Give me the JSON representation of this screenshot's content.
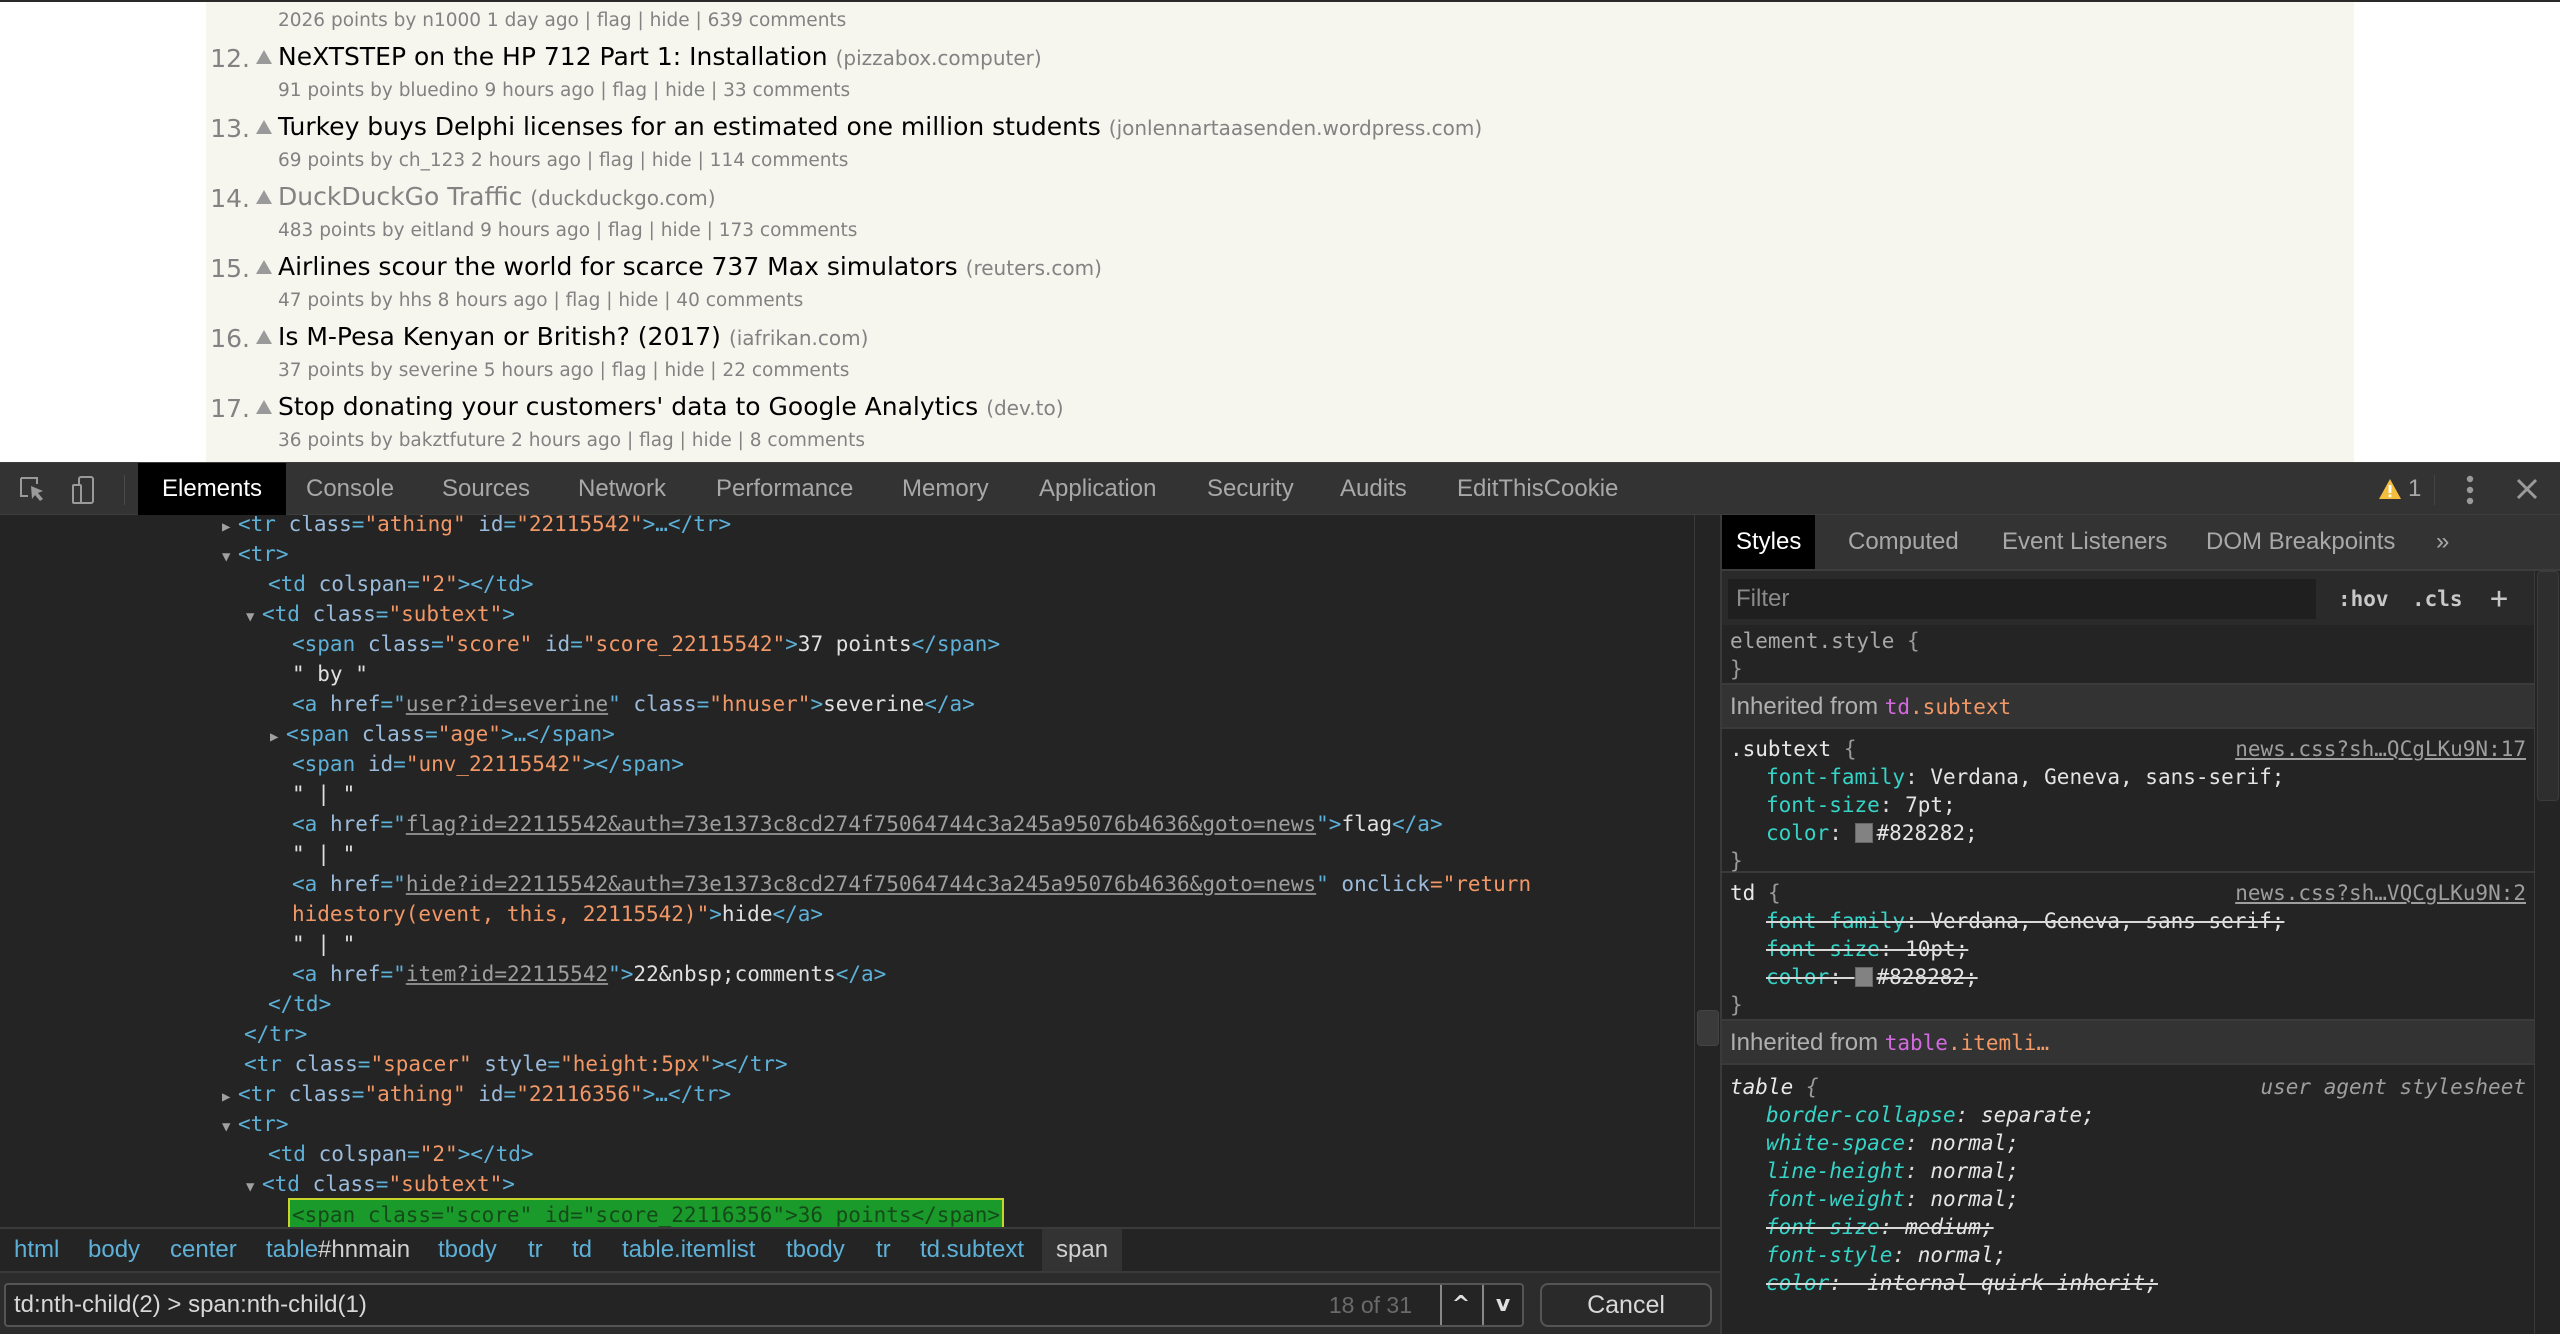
{
  "hn": {
    "partial_item": {
      "subtext": "2026 points by n1000 1 day ago | flag | hide | 639 comments"
    },
    "items": [
      {
        "rank": "12.",
        "title": "NeXTSTEP on the HP 712 Part 1: Installation",
        "site": "(pizzabox.computer)",
        "subtext": "91 points by bluedino 9 hours ago | flag | hide | 33 comments",
        "visited": false
      },
      {
        "rank": "13.",
        "title": "Turkey buys Delphi licenses for an estimated one million students",
        "site": "(jonlennartaasenden.wordpress.com)",
        "subtext": "69 points by ch_123 2 hours ago | flag | hide | 114 comments",
        "visited": false
      },
      {
        "rank": "14.",
        "title": "DuckDuckGo Traffic",
        "site": "(duckduckgo.com)",
        "subtext": "483 points by eitland 9 hours ago | flag | hide | 173 comments",
        "visited": true
      },
      {
        "rank": "15.",
        "title": "Airlines scour the world for scarce 737 Max simulators",
        "site": "(reuters.com)",
        "subtext": "47 points by hhs 8 hours ago | flag | hide | 40 comments",
        "visited": false
      },
      {
        "rank": "16.",
        "title": "Is M-Pesa Kenyan or British? (2017)",
        "site": "(iafrikan.com)",
        "subtext": "37 points by severine 5 hours ago | flag | hide | 22 comments",
        "visited": false
      },
      {
        "rank": "17.",
        "title": "Stop donating your customers' data to Google Analytics",
        "site": "(dev.to)",
        "subtext": "36 points by bakztfuture 2 hours ago | flag | hide | 8 comments",
        "visited": false
      }
    ]
  },
  "devtools": {
    "tabs": [
      "Elements",
      "Console",
      "Sources",
      "Network",
      "Performance",
      "Memory",
      "Application",
      "Security",
      "Audits",
      "EditThisCookie"
    ],
    "active_tab": "Elements",
    "warning_count": "1",
    "icons": {
      "inspect": "inspect-element-icon",
      "device": "device-toolbar-icon",
      "warning": "warning-icon",
      "menu": "kebab-menu-icon",
      "close": "close-icon"
    },
    "dom": {
      "l1": {
        "a_tag": "<tr ",
        "a_attr1": "class",
        "a_val1": "\"athing\"",
        "a_attr2": " id",
        "a_val2": "\"22115542\"",
        "a_close": ">…</tr>"
      },
      "l2": "<tr>",
      "l3": {
        "open": "<td ",
        "attr": "colspan",
        "val": "\"2\"",
        "close": "></td>"
      },
      "l4": {
        "open": "<td ",
        "attr": "class",
        "val": "\"subtext\"",
        "close": ">"
      },
      "l5": {
        "open": "<span ",
        "attr1": "class",
        "val1": "\"score\"",
        "attr2": " id",
        "val2": "\"score_22115542\"",
        "mid": ">",
        "text": "37 points",
        "close": "</span>"
      },
      "l6": "\" by \"",
      "l7": {
        "open": "<a ",
        "attr1": "href",
        "eq": "=\"",
        "link": "user?id=severine",
        "q": "\"",
        "attr2": " class",
        "val2": "\"hnuser\"",
        "mid": ">",
        "text": "severine",
        "close": "</a>"
      },
      "l8": {
        "open": "<span ",
        "attr": "class",
        "val": "\"age\"",
        "close": ">…</span>"
      },
      "l9": {
        "open": "<span ",
        "attr": "id",
        "val": "\"unv_22115542\"",
        "close": "></span>"
      },
      "l10": "\" | \"",
      "l11": {
        "open": "<a ",
        "attr": "href",
        "eq": "=\"",
        "link": "flag?id=22115542&auth=73e1373c8cd274f75064744c3a245a95076b4636&goto=news",
        "q": "\"",
        "mid": ">",
        "text": "flag",
        "close": "</a>"
      },
      "l12": "\" | \"",
      "l13": {
        "open": "<a ",
        "attr": "href",
        "eq": "=\"",
        "link": "hide?id=22115542&auth=73e1373c8cd274f75064744c3a245a95076b4636&goto=news",
        "q": "\"",
        "attr2": " onclick",
        "val2a": "=\"return"
      },
      "l14": {
        "val2b": "hidestory(event, this, 22115542)\"",
        "mid": ">",
        "text": "hide",
        "close": "</a>"
      },
      "l15": "\" | \"",
      "l16": {
        "open": "<a ",
        "attr": "href",
        "eq": "=\"",
        "link": "item?id=22115542",
        "q": "\"",
        "mid": ">",
        "text": "22&nbsp;comments",
        "close": "</a>"
      },
      "l17": "</td>",
      "l18": "</tr>",
      "l19": {
        "open": "<tr ",
        "attr1": "class",
        "val1": "\"spacer\"",
        "attr2": " style",
        "val2": "\"height:5px\"",
        "close": "></tr>"
      },
      "l20": {
        "open": "<tr ",
        "attr1": "class",
        "val1": "\"athing\"",
        "attr2": " id",
        "val2": "\"22116356\"",
        "close": ">…</tr>"
      },
      "l21": "<tr>",
      "l22": {
        "open": "<td ",
        "attr": "colspan",
        "val": "\"2\"",
        "close": "></td>"
      },
      "l23": {
        "open": "<td ",
        "attr": "class",
        "val": "\"subtext\"",
        "close": ">"
      },
      "l24": "<span class=\"score\" id=\"score_22116356\">36 points</span>"
    },
    "breadcrumbs": [
      {
        "tag": "html",
        "id": ""
      },
      {
        "tag": "body",
        "id": ""
      },
      {
        "tag": "center",
        "id": ""
      },
      {
        "tag": "table",
        "id": "#hnmain"
      },
      {
        "tag": "tbody",
        "id": ""
      },
      {
        "tag": "tr",
        "id": ""
      },
      {
        "tag": "td",
        "id": ""
      },
      {
        "tag": "table.itemlist",
        "id": ""
      },
      {
        "tag": "tbody",
        "id": ""
      },
      {
        "tag": "tr",
        "id": ""
      },
      {
        "tag": "td.subtext",
        "id": ""
      },
      {
        "tag": "span",
        "id": ""
      }
    ],
    "search": {
      "value": "td:nth-child(2) > span:nth-child(1)",
      "count": "18 of 31",
      "prev": "^",
      "next": "v",
      "cancel": "Cancel"
    },
    "styles": {
      "tabs": [
        "Styles",
        "Computed",
        "Event Listeners",
        "DOM Breakpoints",
        "»"
      ],
      "active_tab": "Styles",
      "filter_placeholder": "Filter",
      "hov": ":hov",
      "cls": ".cls",
      "add": "+",
      "element_style": {
        "selector": "element.style",
        "open": "{",
        "close": "}"
      },
      "inherited1": {
        "label": "Inherited from ",
        "tag": "td",
        "cls": ".subtext"
      },
      "rule_subtext": {
        "selector": ".subtext",
        "source": "news.css?sh…QCgLKu9N:17",
        "props": [
          {
            "name": "font-family",
            "value": "Verdana, Geneva, sans-serif;"
          },
          {
            "name": "font-size",
            "value": "7pt;"
          },
          {
            "name": "color",
            "value": "#828282;"
          }
        ]
      },
      "rule_td": {
        "selector": "td",
        "source": "news.css?sh…VQCgLKu9N:2",
        "props": [
          {
            "name": "font-family",
            "value": "Verdana, Geneva, sans-serif;"
          },
          {
            "name": "font-size",
            "value": "10pt;"
          },
          {
            "name": "color",
            "value": "#828282;"
          }
        ]
      },
      "inherited2": {
        "label": "Inherited from ",
        "tag": "table",
        "cls": ".itemli…"
      },
      "rule_table": {
        "selector": "table",
        "source": "user agent stylesheet",
        "props": [
          {
            "name": "border-collapse",
            "value": "separate;",
            "struck": false
          },
          {
            "name": "white-space",
            "value": "normal;",
            "struck": false
          },
          {
            "name": "line-height",
            "value": "normal;",
            "struck": false
          },
          {
            "name": "font-weight",
            "value": "normal;",
            "struck": false
          },
          {
            "name": "font-size",
            "value": "medium;",
            "struck": true
          },
          {
            "name": "font-style",
            "value": "normal;",
            "struck": false
          },
          {
            "name": "color",
            "value": "-internal-quirk-inherit;",
            "struck": true
          }
        ]
      },
      "swatch_color": "#828282"
    }
  }
}
